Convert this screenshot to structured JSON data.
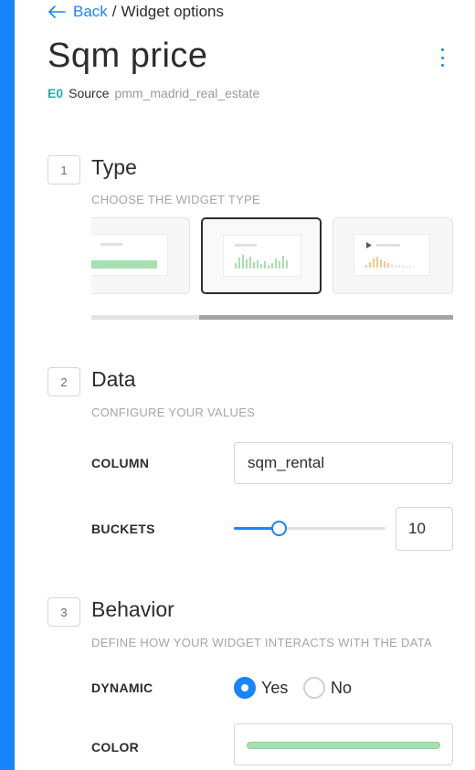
{
  "colors": {
    "accent": "#1785fb",
    "source_id": "#1eb2a5",
    "widget_color": "#a6e0b0",
    "histogram_bar": "#a6e0b0",
    "timeseries_bar": "#f5c98b"
  },
  "breadcrumb": {
    "back_label": "Back",
    "separator": "/",
    "current": "Widget options"
  },
  "header": {
    "title": "Sqm price",
    "menu_icon": "kebab-menu-icon",
    "source_id": "E0",
    "source_label": "Source",
    "source_name": "pmm_madrid_real_estate"
  },
  "sections": {
    "type": {
      "number": "1",
      "title": "Type",
      "subtitle": "CHOOSE THE WIDGET TYPE",
      "cards": [
        {
          "name": "category-widget",
          "selected": false
        },
        {
          "name": "histogram-widget",
          "selected": true
        },
        {
          "name": "time-series-widget",
          "selected": false
        }
      ]
    },
    "data": {
      "number": "2",
      "title": "Data",
      "subtitle": "CONFIGURE YOUR VALUES",
      "column_label": "COLUMN",
      "column_value": "sqm_rental",
      "buckets_label": "BUCKETS",
      "buckets_value": "10",
      "buckets_fraction": 0.3
    },
    "behavior": {
      "number": "3",
      "title": "Behavior",
      "subtitle": "DEFINE HOW YOUR WIDGET INTERACTS WITH THE DATA",
      "dynamic_label": "DYNAMIC",
      "options": [
        "Yes",
        "No"
      ],
      "selected_option": "Yes",
      "color_label": "COLOR"
    }
  }
}
